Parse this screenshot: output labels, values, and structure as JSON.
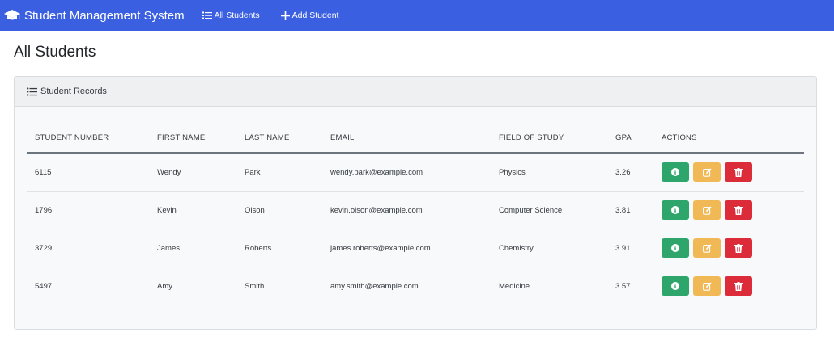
{
  "navbar": {
    "brand": "Student Management System",
    "links": [
      {
        "label": "All Students",
        "icon": "list-icon"
      },
      {
        "label": "Add Student",
        "icon": "plus-icon"
      }
    ]
  },
  "page": {
    "title": "All Students"
  },
  "card": {
    "header": "Student Records"
  },
  "table": {
    "columns": [
      "STUDENT NUMBER",
      "FIRST NAME",
      "LAST NAME",
      "EMAIL",
      "FIELD OF STUDY",
      "GPA",
      "ACTIONS"
    ],
    "rows": [
      {
        "number": "6115",
        "first": "Wendy",
        "last": "Park",
        "email": "wendy.park@example.com",
        "field": "Physics",
        "gpa": "3.26"
      },
      {
        "number": "1796",
        "first": "Kevin",
        "last": "Olson",
        "email": "kevin.olson@example.com",
        "field": "Computer Science",
        "gpa": "3.81"
      },
      {
        "number": "3729",
        "first": "James",
        "last": "Roberts",
        "email": "james.roberts@example.com",
        "field": "Chemistry",
        "gpa": "3.91"
      },
      {
        "number": "5497",
        "first": "Amy",
        "last": "Smith",
        "email": "amy.smith@example.com",
        "field": "Medicine",
        "gpa": "3.57"
      }
    ],
    "actions": [
      {
        "name": "info",
        "icon": "info-icon",
        "color": "#2ea56a"
      },
      {
        "name": "edit",
        "icon": "edit-icon",
        "color": "#f0b955"
      },
      {
        "name": "delete",
        "icon": "trash-icon",
        "color": "#dc2b39"
      }
    ]
  },
  "colors": {
    "navbar": "#3a5fe0",
    "info": "#2ea56a",
    "edit": "#f0b955",
    "delete": "#dc2b39"
  }
}
